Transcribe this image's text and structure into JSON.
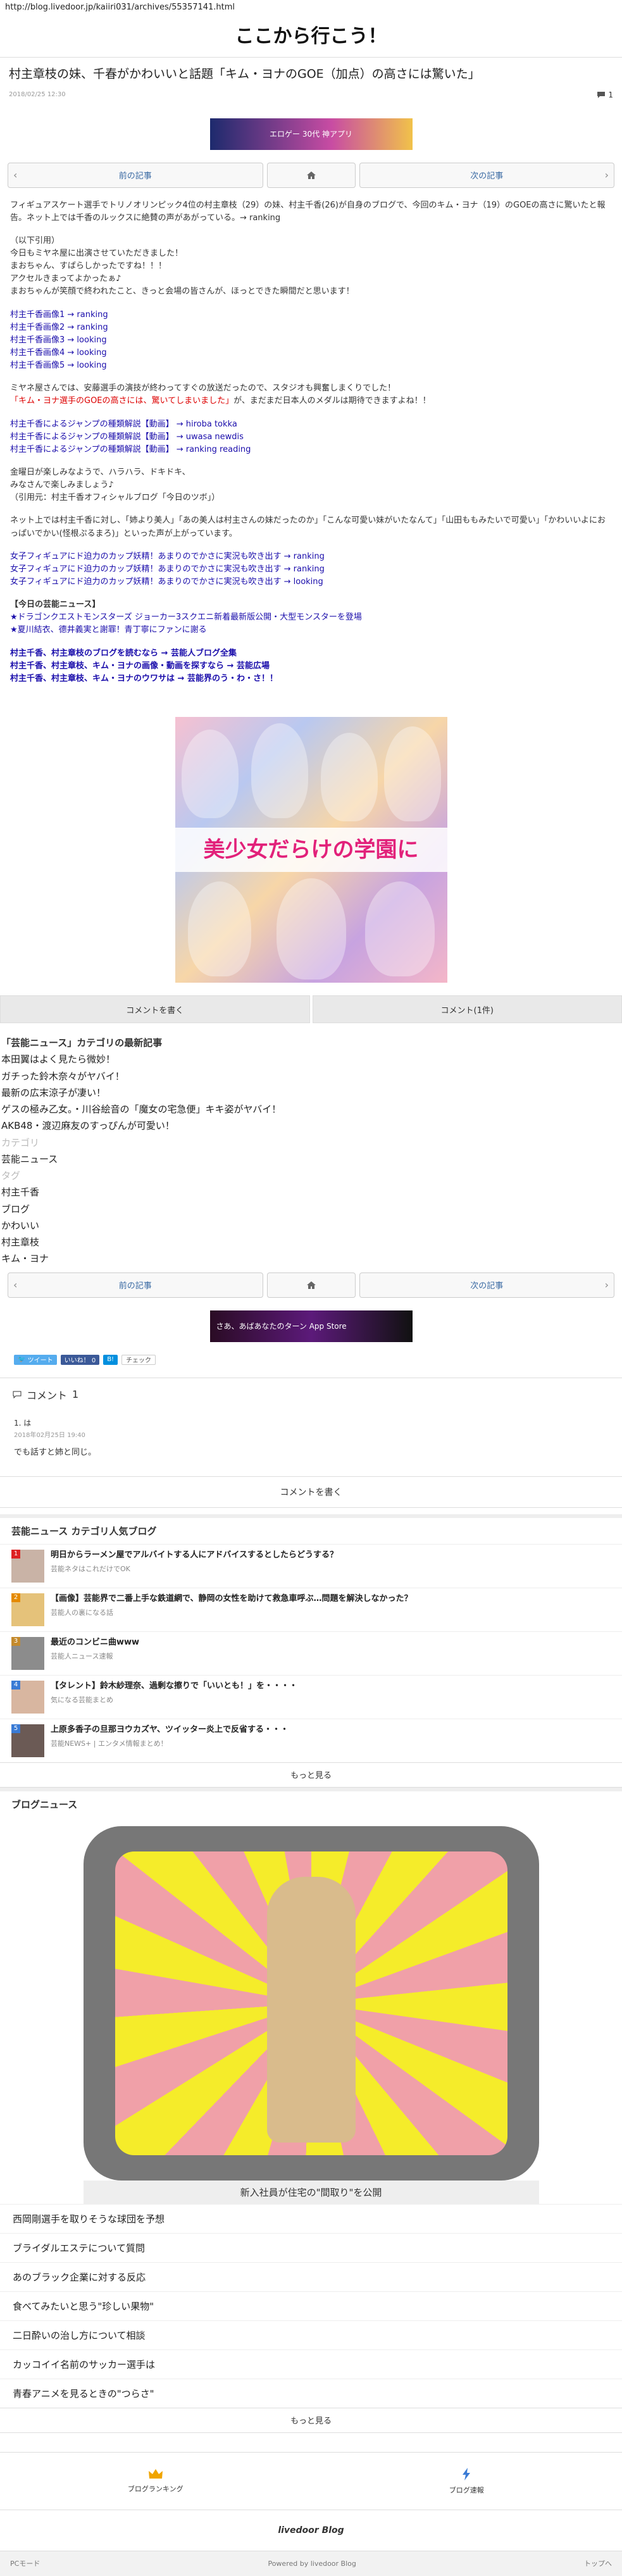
{
  "url": "http://blog.livedoor.jp/kaiiri031/archives/55357141.html",
  "site_title": "ここから行こう！",
  "article": {
    "title": "村主章枝の妹、千春がかわいいと話題「キム・ヨナのGOE（加点）の高さには驚いた」",
    "date": "2018/02/25 12:30",
    "comment_count": "1"
  },
  "ad_top": "エロゲー 30代 神アプリ",
  "pager": {
    "prev": "前の記事",
    "next": "次の記事"
  },
  "body": {
    "p1": "フィギュアスケート選手でトリノオリンピック4位の村主章枝（29）の妹、村主千香(26)が自身のブログで、今回のキム・ヨナ（19）のGOEの高さに驚いたと報告。ネット上では千香のルックスに絶賛の声があがっている。→ ranking",
    "p2_lines": [
      "（以下引用）",
      "今日もミヤネ屋に出演させていただきました！",
      "まおちゃん、すばらしかったですね！！！",
      "アクセルきまってよかったぁ♪",
      "まおちゃんが笑顔で終われたこと、きっと会場の皆さんが、ほっとできた瞬間だと思います！"
    ],
    "images": [
      "村主千香画像1 → ranking",
      "村主千香画像2 → ranking",
      "村主千香画像3 → looking",
      "村主千香画像4 → looking",
      "村主千香画像5 → looking"
    ],
    "p4": "ミヤネ屋さんでは、安藤選手の演技が終わってすぐの放送だったので、スタジオも興奮しまくりでした！",
    "p4_red": "「キム・ヨナ選手のGOEの高さには、驚いてしまいました」",
    "p4_tail": "が、まだまだ日本人のメダルは期待できますよね！！",
    "jumps": [
      "村主千香によるジャンプの種類解説【動画】 → hiroba tokka",
      "村主千香によるジャンプの種類解説【動画】 → uwasa newdis",
      "村主千香によるジャンプの種類解説【動画】 → ranking reading"
    ],
    "p6_lines": [
      "金曜日が楽しみなようで、ハラハラ、ドキドキ、",
      "みなさんで楽しみましょう♪",
      "（引用元：村主千香オフィシャルブログ「今日のツボ」）"
    ],
    "p7": "ネット上では村主千香に対し、「姉より美人」「あの美人は村主さんの妹だったのか」「こんな可愛い妹がいたなんて」「山田ももみたいで可愛い」「かわいいよにおっぱいでかい(怪根ぷるまろ)」といった声が上がっています。",
    "girls": [
      "女子フィギュアにド迫力のカップ妖精！あまりのでかさに実況も吹き出す → ranking",
      "女子フィギュアにド迫力のカップ妖精！あまりのでかさに実況も吹き出す → ranking",
      "女子フィギュアにド迫力のカップ妖精！あまりのでかさに実況も吹き出す → looking"
    ],
    "today_h": "【今日の芸能ニュース】",
    "today": [
      "★ドラゴンクエストモンスターズ ジョーカー3スクエニ新着最新版公開・大型モンスターを登場",
      "★夏川結衣、德井義実と謝罪！青丁寧にファンに謝る"
    ],
    "finals": [
      "村主千香、村主章枝のブログを読むなら → 芸能人ブログ全集",
      "村主千香、村主章枝、キム・ヨナの画像・動画を探すなら → 芸能広場",
      "村主千香、村主章枝、キム・ヨナのウワサは → 芸能界のう・わ・さ！！"
    ]
  },
  "illust_text": "美少女だらけの学園に",
  "buttons": {
    "write": "コメントを書く",
    "comments": "コメント(1件)"
  },
  "category": {
    "heading": "「芸能ニュース」カテゴリの最新記事",
    "items": [
      "本田翼はよく見たら微妙！",
      "ガチった鈴木奈々がヤバイ！",
      "最新の広末涼子が凄い！",
      "ゲスの極み乙女。・川谷絵音の「魔女の宅急便」キキ姿がヤバイ！",
      "AKB48・渡辺麻友のすっぴんが可愛い！"
    ],
    "cat_label": "カテゴリ",
    "cat_value": "芸能ニュース",
    "tag_label": "タグ",
    "tags": [
      "村主千香",
      "ブログ",
      "かわいい",
      "村主章枝",
      "キム・ヨナ"
    ]
  },
  "ad_bottom": "さあ、あばあなたのターン  App Store",
  "social": {
    "tweet": "ツイート",
    "like": "いいね！ 0",
    "share": "B!",
    "check": "チェック"
  },
  "comments": {
    "heading": "コメント",
    "count": "1",
    "items": [
      {
        "no": "1. は",
        "date": "2018年02月25日 19:40",
        "text": "でも話すと姉と同じ。"
      }
    ],
    "write": "コメントを書く"
  },
  "popular": {
    "heading": "芸能ニュース カテゴリ人気ブログ",
    "items": [
      {
        "rank": "1",
        "title": "明日からラーメン屋でアルバイトする人にアドバイスするとしたらどうする？",
        "src": "芸能ネタはこれだけでOK"
      },
      {
        "rank": "2",
        "title": "【画像】芸能界で二番上手な鉄道網で、静岡の女性を助けて救急車呼ぶ…問題を解決しなかった？",
        "src": "芸能人の裏になる話"
      },
      {
        "rank": "3",
        "title": "最近のコンビニ曲www",
        "src": "芸能人ニュース速報"
      },
      {
        "rank": "4",
        "title": "【タレント】鈴木紗理奈、過剰な擦りで「いいとも！」を・・・・",
        "src": "気になる芸能まとめ"
      },
      {
        "rank": "5",
        "title": "上原多香子の旦那ヨウカズヤ、ツイッター炎上で反省する・・・",
        "src": "芸能NEWS+ | エンタメ情報まとめ！"
      }
    ],
    "more": "もっと見る"
  },
  "news": {
    "heading": "ブログニュース",
    "caption": "新入社員が住宅の\"間取り\"を公開",
    "items": [
      "西岡剛選手を取りそうな球団を予想",
      "ブライダルエステについて質問",
      "あのブラック企業に対する反応",
      "食べてみたいと思う\"珍しい果物\"",
      "二日酔いの治し方について相談",
      "カッコイイ名前のサッカー選手は",
      "青春アニメを見るときの\"つらさ\""
    ],
    "more": "もっと見る"
  },
  "footer": {
    "ranking": "ブログランキング",
    "news": "ブログ速報",
    "brand": "livedoor Blog",
    "pc": "PCモード",
    "powered": "Powered by livedoor Blog",
    "top": "トップへ"
  },
  "colors": {
    "red_text": "#dd0000",
    "twitter": "#55acee",
    "facebook": "#3b5998",
    "hatena": "#008fde"
  }
}
